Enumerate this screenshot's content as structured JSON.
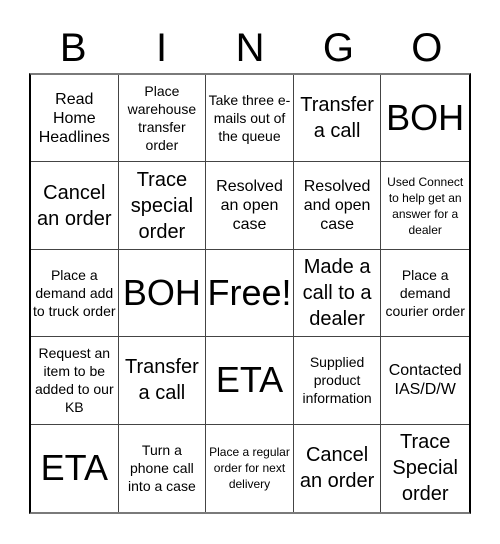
{
  "header": [
    "B",
    "I",
    "N",
    "G",
    "O"
  ],
  "cells": [
    {
      "text": "Read Home Headlines",
      "size": "m"
    },
    {
      "text": "Place warehouse transfer order",
      "size": "s"
    },
    {
      "text": "Take three e-mails out of the queue",
      "size": "s"
    },
    {
      "text": "Transfer a call",
      "size": "l"
    },
    {
      "text": "BOH",
      "size": "xl"
    },
    {
      "text": "Cancel an order",
      "size": "l"
    },
    {
      "text": "Trace special order",
      "size": "l"
    },
    {
      "text": "Resolved an open case",
      "size": "m"
    },
    {
      "text": "Resolved and open case",
      "size": "m"
    },
    {
      "text": "Used Connect to help get an answer for a dealer",
      "size": "xs"
    },
    {
      "text": "Place a demand add to truck order",
      "size": "s"
    },
    {
      "text": "BOH",
      "size": "xl"
    },
    {
      "text": "Free!",
      "size": "xl"
    },
    {
      "text": "Made a call to a dealer",
      "size": "l"
    },
    {
      "text": "Place a demand courier order",
      "size": "s"
    },
    {
      "text": "Request an item to be added to our KB",
      "size": "s"
    },
    {
      "text": "Transfer a call",
      "size": "l"
    },
    {
      "text": "ETA",
      "size": "xl"
    },
    {
      "text": "Supplied product information",
      "size": "s"
    },
    {
      "text": "Contacted IAS/D/W",
      "size": "m"
    },
    {
      "text": "ETA",
      "size": "xl"
    },
    {
      "text": "Turn a phone call into a case",
      "size": "s"
    },
    {
      "text": "Place a regular order for next delivery",
      "size": "xs"
    },
    {
      "text": "Cancel an order",
      "size": "l"
    },
    {
      "text": "Trace Special order",
      "size": "l"
    }
  ]
}
